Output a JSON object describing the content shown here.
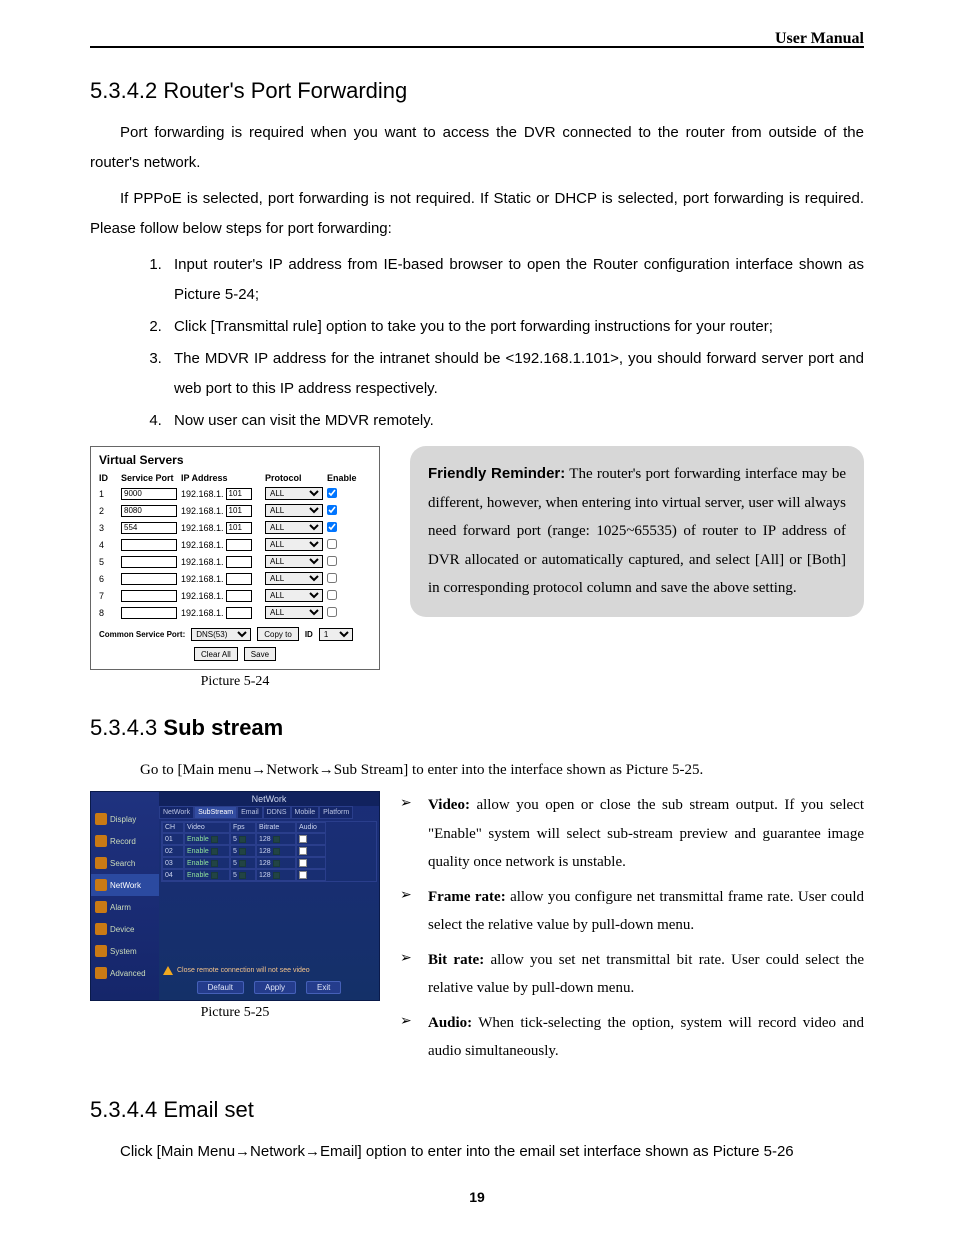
{
  "header": {
    "title": "User  Manual"
  },
  "sec5342": {
    "heading_num": "5.3.4.2",
    "heading_title": "Router's Port Forwarding",
    "p1": "Port forwarding is required when you want to access the DVR connected to the router from outside of the router's network.",
    "p2": "If PPPoE is selected, port forwarding is not required. If Static or DHCP is selected, port forwarding is required. Please follow below steps for port forwarding:",
    "steps": [
      "Input router's IP address from IE-based browser to open the Router configuration interface shown as Picture 5-24;",
      "Click [Transmittal rule] option to take you to the port forwarding instructions for your router;",
      "The MDVR IP address for the intranet should be <192.168.1.101>, you should forward server port and web port to this IP address respectively.",
      "Now user can visit the MDVR remotely."
    ]
  },
  "virtual_servers": {
    "title": "Virtual Servers",
    "columns": {
      "id": "ID",
      "service_port": "Service Port",
      "ip": "IP Address",
      "protocol": "Protocol",
      "enable": "Enable"
    },
    "ip_prefix": "192.168.1.",
    "protocol_value": "ALL",
    "rows": [
      {
        "id": "1",
        "port": "9000",
        "ip_last": "101",
        "enabled": true
      },
      {
        "id": "2",
        "port": "8080",
        "ip_last": "101",
        "enabled": true
      },
      {
        "id": "3",
        "port": "554",
        "ip_last": "101",
        "enabled": true
      },
      {
        "id": "4",
        "port": "",
        "ip_last": "",
        "enabled": false
      },
      {
        "id": "5",
        "port": "",
        "ip_last": "",
        "enabled": false
      },
      {
        "id": "6",
        "port": "",
        "ip_last": "",
        "enabled": false
      },
      {
        "id": "7",
        "port": "",
        "ip_last": "",
        "enabled": false
      },
      {
        "id": "8",
        "port": "",
        "ip_last": "",
        "enabled": false
      }
    ],
    "csp_label": "Common Service Port:",
    "csp_value": "DNS(53)",
    "copyto_label": "Copy to",
    "copyto_id_label": "ID",
    "copyto_id_value": "1",
    "clear_all": "Clear All",
    "save": "Save",
    "caption": "Picture 5-24"
  },
  "reminder": {
    "title": "Friendly Reminder:",
    "body": " The router's port forwarding interface may be different, however, when entering into virtual server, user will always need forward port (range: 1025~65535) of router to IP address of DVR allocated or automatically captured, and select [All] or [Both] in corresponding protocol column and save the above setting."
  },
  "sec5343": {
    "heading_num": "5.3.4.3",
    "heading_title": "Sub stream",
    "goto": "Go to [Main menu→Network→Sub Stream] to enter into the interface shown as Picture 5-25.",
    "caption": "Picture 5-25",
    "bullets": [
      {
        "label": "Video:",
        "text": " allow you open or close the sub stream output. If you select \"Enable\" system will select sub-stream preview and guarantee image quality once network is unstable."
      },
      {
        "label": "Frame rate:",
        "text": " allow you configure net transmittal frame rate. User could select the relative value by pull-down menu."
      },
      {
        "label": "Bit rate:",
        "text": " allow you set net transmittal bit rate. User could select the relative value by pull-down menu."
      },
      {
        "label": "Audio:",
        "text": " When tick-selecting the option, system will record video and audio simultaneously."
      }
    ]
  },
  "substream_ui": {
    "title": "NetWork",
    "side_items": [
      "Display",
      "Record",
      "Search",
      "NetWork",
      "Alarm",
      "Device",
      "System",
      "Advanced"
    ],
    "side_active_index": 3,
    "tabs": [
      "NetWork",
      "SubStream",
      "Email",
      "DDNS",
      "Mobile",
      "Platform"
    ],
    "tab_active_index": 1,
    "grid_head": {
      "ch": "CH",
      "video": "Video",
      "fps": "Fps",
      "bitrate": "Bitrate",
      "audio": "Audio"
    },
    "grid_rows": [
      {
        "ch": "01",
        "video": "Enable",
        "fps": "5",
        "bitrate": "128"
      },
      {
        "ch": "02",
        "video": "Enable",
        "fps": "5",
        "bitrate": "128"
      },
      {
        "ch": "03",
        "video": "Enable",
        "fps": "5",
        "bitrate": "128"
      },
      {
        "ch": "04",
        "video": "Enable",
        "fps": "5",
        "bitrate": "128"
      }
    ],
    "warn": "Close remote connection will not see video",
    "btns": {
      "default": "Default",
      "apply": "Apply",
      "exit": "Exit"
    }
  },
  "sec5344": {
    "heading_num": "5.3.4.4",
    "heading_title": "Email set",
    "p1": "Click [Main Menu→Network→Email] option to enter into the email set interface shown as Picture 5-26"
  },
  "page_number": "19"
}
